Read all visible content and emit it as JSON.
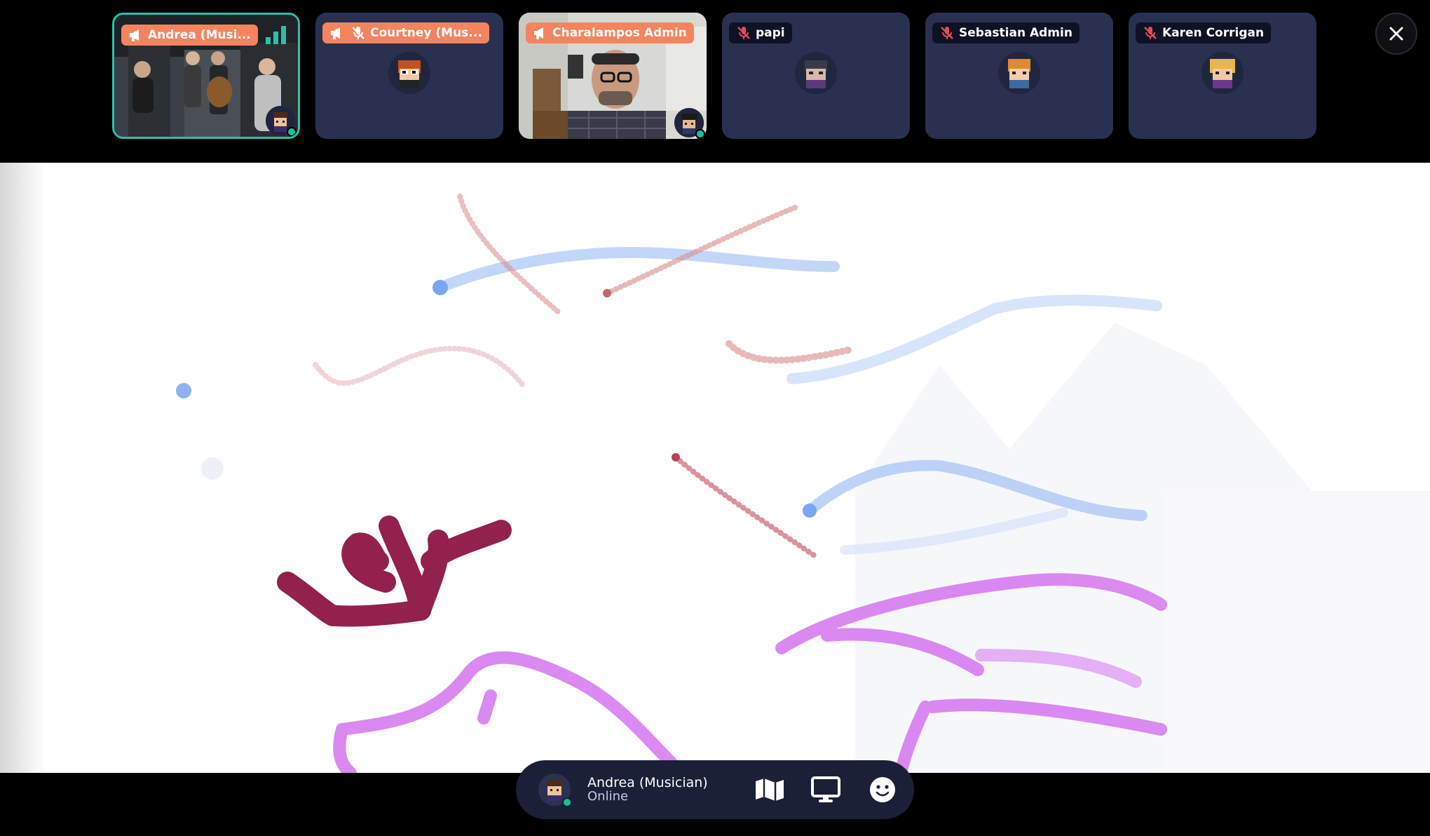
{
  "participants": [
    {
      "name": "Andrea (Musi...",
      "speaker": true,
      "muted": false
    },
    {
      "name": "Courtney (Mus...",
      "speaker": true,
      "muted": true
    },
    {
      "name": "Charalampos Admin",
      "speaker": true,
      "muted": false
    },
    {
      "name": "papi",
      "speaker": false,
      "muted": true
    },
    {
      "name": "Sebastian Admin",
      "speaker": false,
      "muted": true
    },
    {
      "name": "Karen Corrigan",
      "speaker": false,
      "muted": true
    }
  ],
  "dock": {
    "user_name": "Andrea (Musician)",
    "user_status": "Online"
  },
  "icons": {
    "speaker": "megaphone-icon",
    "muted": "microphone-off-icon",
    "close": "close-icon",
    "map": "map-icon",
    "screen": "screen-share-icon",
    "emoji": "emoji-icon"
  },
  "colors": {
    "tile_bg": "#2a3050",
    "speaker_tag": "#f4845f",
    "active_border": "#2fbfa6",
    "online": "#12c29a",
    "dock_bg": "#1b2038"
  }
}
